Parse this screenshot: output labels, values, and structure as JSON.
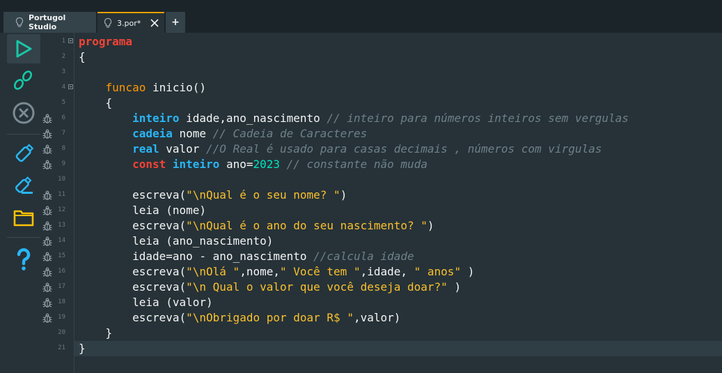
{
  "tabs": {
    "studio_label": "Portugol Studio",
    "file_label": "3.por*",
    "add_label": "+"
  },
  "toolbar": {
    "icons": [
      "play-icon",
      "step-icon",
      "stop-icon",
      "save-icon",
      "save-as-icon",
      "folder-icon",
      "help-icon"
    ]
  },
  "colors": {
    "accent": "#f0a000",
    "keyword_red": "#f44336",
    "keyword_orange": "#ff9800",
    "keyword_blue": "#29b6f6",
    "string": "#fbc02d",
    "number": "#00e5c0",
    "comment": "#6f8088",
    "background": "#263238"
  },
  "editor": {
    "lines": [
      {
        "no": "1",
        "fold": true,
        "bug": false,
        "tokens": [
          [
            "kw-red",
            "programa"
          ]
        ]
      },
      {
        "no": "2",
        "fold": false,
        "bug": false,
        "tokens": [
          [
            "txt",
            "{"
          ]
        ]
      },
      {
        "no": "3",
        "fold": false,
        "bug": false,
        "tokens": []
      },
      {
        "no": "4",
        "fold": true,
        "bug": false,
        "tokens": [
          [
            "txt",
            "    "
          ],
          [
            "kw-orange",
            "funcao"
          ],
          [
            "txt",
            " inicio()"
          ]
        ]
      },
      {
        "no": "5",
        "fold": false,
        "bug": false,
        "tokens": [
          [
            "txt",
            "    {"
          ]
        ]
      },
      {
        "no": "6",
        "fold": false,
        "bug": true,
        "tokens": [
          [
            "txt",
            "        "
          ],
          [
            "kw-blue",
            "inteiro"
          ],
          [
            "txt",
            " idade,ano_nascimento "
          ],
          [
            "cmt",
            "// inteiro para números inteiros sem vergulas"
          ]
        ]
      },
      {
        "no": "7",
        "fold": false,
        "bug": true,
        "tokens": [
          [
            "txt",
            "        "
          ],
          [
            "kw-blue",
            "cadeia"
          ],
          [
            "txt",
            " nome "
          ],
          [
            "cmt",
            "// Cadeia de Caracteres"
          ]
        ]
      },
      {
        "no": "8",
        "fold": false,
        "bug": true,
        "tokens": [
          [
            "txt",
            "        "
          ],
          [
            "kw-blue",
            "real"
          ],
          [
            "txt",
            " valor "
          ],
          [
            "cmt",
            "//O Real é usado para casas decimais , números com virgulas"
          ]
        ]
      },
      {
        "no": "9",
        "fold": false,
        "bug": true,
        "tokens": [
          [
            "txt",
            "        "
          ],
          [
            "kw-red",
            "const"
          ],
          [
            "txt",
            " "
          ],
          [
            "kw-blue",
            "inteiro"
          ],
          [
            "txt",
            " ano="
          ],
          [
            "num",
            "2023"
          ],
          [
            "txt",
            " "
          ],
          [
            "cmt",
            "// constante não muda"
          ]
        ]
      },
      {
        "no": "10",
        "fold": false,
        "bug": false,
        "tokens": []
      },
      {
        "no": "11",
        "fold": false,
        "bug": true,
        "tokens": [
          [
            "txt",
            "        escreva("
          ],
          [
            "str",
            "\"\\nQual é o seu nome? \""
          ],
          [
            "txt",
            ")"
          ]
        ]
      },
      {
        "no": "12",
        "fold": false,
        "bug": true,
        "tokens": [
          [
            "txt",
            "        leia (nome)"
          ]
        ]
      },
      {
        "no": "13",
        "fold": false,
        "bug": true,
        "tokens": [
          [
            "txt",
            "        escreva("
          ],
          [
            "str",
            "\"\\nQual é o ano do seu nascimento? \""
          ],
          [
            "txt",
            ")"
          ]
        ]
      },
      {
        "no": "14",
        "fold": false,
        "bug": true,
        "tokens": [
          [
            "txt",
            "        leia (ano_nascimento)"
          ]
        ]
      },
      {
        "no": "15",
        "fold": false,
        "bug": true,
        "tokens": [
          [
            "txt",
            "        idade=ano - ano_nascimento "
          ],
          [
            "cmt",
            "//calcula idade"
          ]
        ]
      },
      {
        "no": "16",
        "fold": false,
        "bug": true,
        "tokens": [
          [
            "txt",
            "        escreva("
          ],
          [
            "str",
            "\"\\nOlá \""
          ],
          [
            "txt",
            ",nome,"
          ],
          [
            "str",
            "\" Você tem \""
          ],
          [
            "txt",
            ",idade, "
          ],
          [
            "str",
            "\" anos\""
          ],
          [
            "txt",
            " )"
          ]
        ]
      },
      {
        "no": "17",
        "fold": false,
        "bug": true,
        "tokens": [
          [
            "txt",
            "        escreva("
          ],
          [
            "str",
            "\"\\n Qual o valor que você deseja doar?\""
          ],
          [
            "txt",
            " )"
          ]
        ]
      },
      {
        "no": "18",
        "fold": false,
        "bug": true,
        "tokens": [
          [
            "txt",
            "        leia (valor)"
          ]
        ]
      },
      {
        "no": "19",
        "fold": false,
        "bug": true,
        "tokens": [
          [
            "txt",
            "        escreva("
          ],
          [
            "str",
            "\"\\nObrigado por doar R$ \""
          ],
          [
            "txt",
            ",valor)"
          ]
        ]
      },
      {
        "no": "20",
        "fold": false,
        "bug": false,
        "tokens": [
          [
            "txt",
            "    }"
          ]
        ]
      },
      {
        "no": "21",
        "fold": false,
        "bug": false,
        "current": true,
        "tokens": [
          [
            "txt",
            "}"
          ]
        ]
      }
    ]
  }
}
